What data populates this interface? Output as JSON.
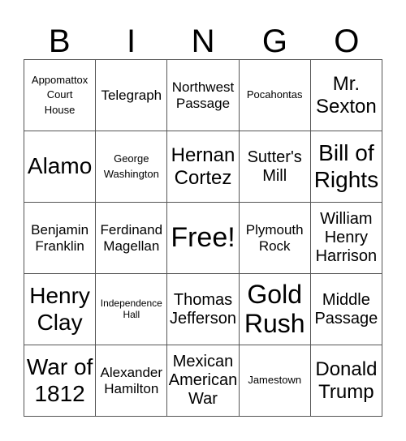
{
  "header": {
    "letters": [
      "B",
      "I",
      "N",
      "G",
      "O"
    ]
  },
  "cells": [
    {
      "text": "Appomattox\nCourt\nHouse",
      "size": "fs-s"
    },
    {
      "text": "Telegraph",
      "size": "fs-m"
    },
    {
      "text": "Northwest\nPassage",
      "size": "fs-m"
    },
    {
      "text": "Pocahontas",
      "size": "fs-s"
    },
    {
      "text": "Mr.\nSexton",
      "size": "fs-xl"
    },
    {
      "text": "Alamo",
      "size": "fs-xxl"
    },
    {
      "text": "George\nWashington",
      "size": "fs-s"
    },
    {
      "text": "Hernan\nCortez",
      "size": "fs-xl"
    },
    {
      "text": "Sutter's\nMill",
      "size": "fs-l"
    },
    {
      "text": "Bill of\nRights",
      "size": "fs-xxl"
    },
    {
      "text": "Benjamin\nFranklin",
      "size": "fs-m"
    },
    {
      "text": "Ferdinand\nMagellan",
      "size": "fs-m"
    },
    {
      "text": "Free!",
      "size": "fs-free"
    },
    {
      "text": "Plymouth\nRock",
      "size": "fs-m"
    },
    {
      "text": "William\nHenry\nHarrison",
      "size": "fs-l"
    },
    {
      "text": "Henry\nClay",
      "size": "fs-xxl"
    },
    {
      "text": "Independence\nHall",
      "size": "fs-xs"
    },
    {
      "text": "Thomas\nJefferson",
      "size": "fs-l"
    },
    {
      "text": "Gold\nRush",
      "size": "fs-big"
    },
    {
      "text": "Middle\nPassage",
      "size": "fs-l"
    },
    {
      "text": "War of\n1812",
      "size": "fs-xxl"
    },
    {
      "text": "Alexander\nHamilton",
      "size": "fs-m"
    },
    {
      "text": "Mexican\nAmerican\nWar",
      "size": "fs-l"
    },
    {
      "text": "Jamestown",
      "size": "fs-s"
    },
    {
      "text": "Donald\nTrump",
      "size": "fs-xl"
    }
  ]
}
